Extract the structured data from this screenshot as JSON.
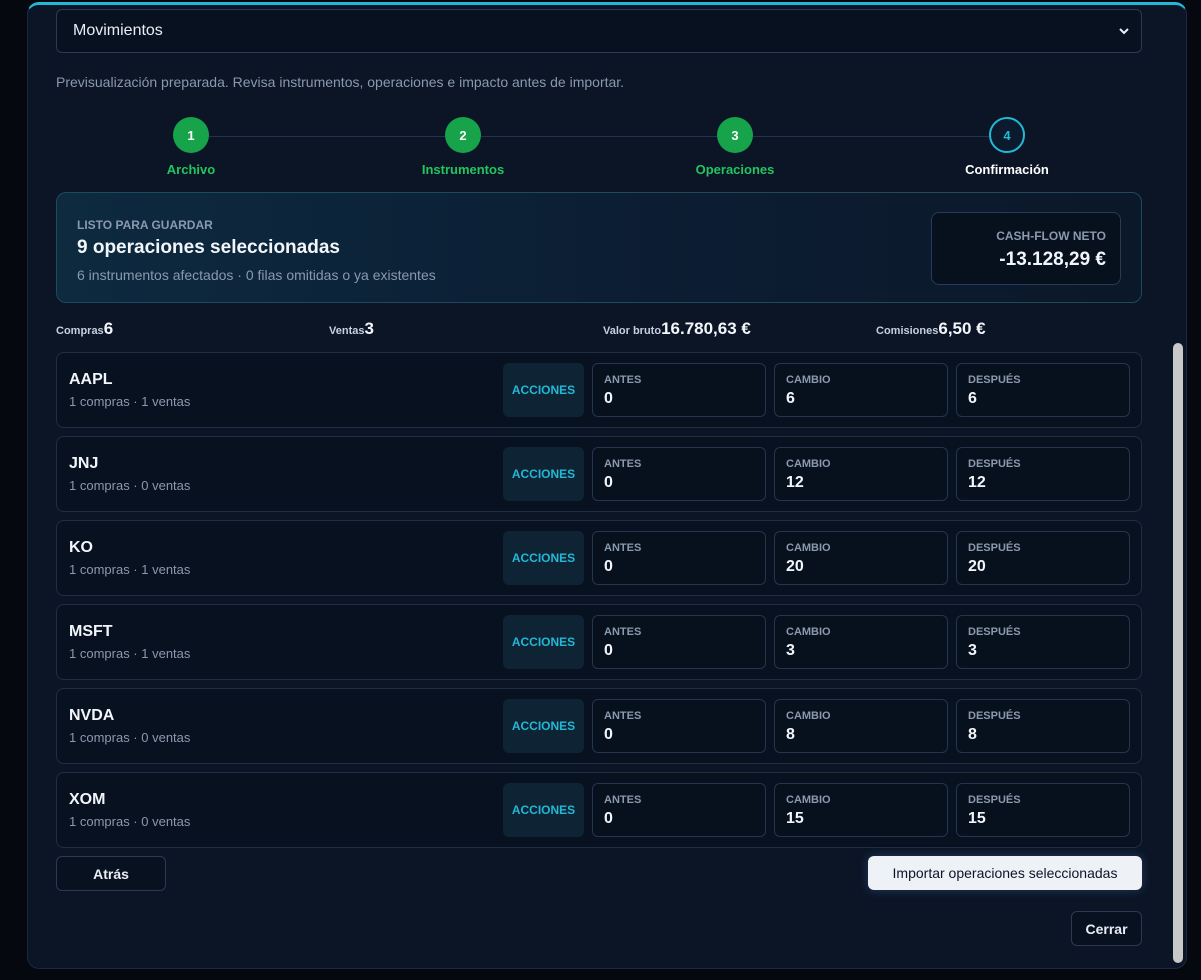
{
  "selector": {
    "value": "Movimientos"
  },
  "hint": "Previsualización preparada. Revisa instrumentos, operaciones e impacto antes de importar.",
  "steps": [
    {
      "number": "1",
      "label": "Archivo",
      "state": "done"
    },
    {
      "number": "2",
      "label": "Instrumentos",
      "state": "done"
    },
    {
      "number": "3",
      "label": "Operaciones",
      "state": "done"
    },
    {
      "number": "4",
      "label": "Confirmación",
      "state": "active"
    }
  ],
  "ready": {
    "kicker": "LISTO PARA GUARDAR",
    "title": "9 operaciones seleccionadas",
    "subtitle": "6 instrumentos afectados · 0 filas omitidas o ya existentes",
    "cash_label": "CASH-FLOW NETO",
    "cash_value": "-13.128,29 €"
  },
  "stats": [
    {
      "label": "Compras",
      "value": "6"
    },
    {
      "label": "Ventas",
      "value": "3"
    },
    {
      "label": "Valor bruto",
      "value": "16.780,63 €"
    },
    {
      "label": "Comisiones",
      "value": "6,50 €"
    }
  ],
  "columns": {
    "before": "ANTES",
    "change": "CAMBIO",
    "after": "DESPUÉS"
  },
  "instruments": [
    {
      "ticker": "AAPL",
      "meta": "1 compras · 1 ventas",
      "type": "ACCIONES",
      "before": "0",
      "change": "6",
      "after": "6"
    },
    {
      "ticker": "JNJ",
      "meta": "1 compras · 0 ventas",
      "type": "ACCIONES",
      "before": "0",
      "change": "12",
      "after": "12"
    },
    {
      "ticker": "KO",
      "meta": "1 compras · 1 ventas",
      "type": "ACCIONES",
      "before": "0",
      "change": "20",
      "after": "20"
    },
    {
      "ticker": "MSFT",
      "meta": "1 compras · 1 ventas",
      "type": "ACCIONES",
      "before": "0",
      "change": "3",
      "after": "3"
    },
    {
      "ticker": "NVDA",
      "meta": "1 compras · 0 ventas",
      "type": "ACCIONES",
      "before": "0",
      "change": "8",
      "after": "8"
    },
    {
      "ticker": "XOM",
      "meta": "1 compras · 0 ventas",
      "type": "ACCIONES",
      "before": "0",
      "change": "15",
      "after": "15"
    }
  ],
  "buttons": {
    "back": "Atrás",
    "import": "Importar operaciones seleccionadas",
    "close": "Cerrar"
  },
  "colors": {
    "accent": "#22b8d6",
    "success": "#17a34a",
    "panel": "#0b1526"
  }
}
